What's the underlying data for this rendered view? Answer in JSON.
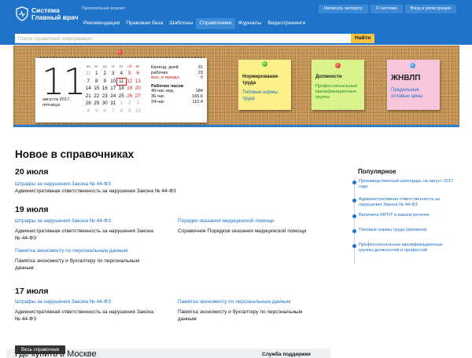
{
  "header": {
    "logo_line1": "Система",
    "logo_line2": "Главный врач",
    "promo": "Промоальная версия",
    "buttons": [
      "Написать эксперту",
      "О системе",
      "Вход и регистрация"
    ],
    "nav": [
      "Рекомендации",
      "Правовая база",
      "Шаблоны",
      "Справочники",
      "Журналы",
      "Видеотренинги"
    ],
    "active_nav": "Справочники"
  },
  "search": {
    "placeholder": "Поиск справочной информации",
    "button": "Найти"
  },
  "calendar": {
    "day": "11",
    "date_line1": "августа 2017,",
    "date_line2": "пятница",
    "weekdays": [
      "пн",
      "вт",
      "ср",
      "чт",
      "пт",
      "сб",
      "вс"
    ],
    "rows": [
      [
        "31",
        "1",
        "2",
        "3",
        "4",
        "5",
        "6"
      ],
      [
        "7",
        "8",
        "9",
        "10",
        "11",
        "12",
        "13"
      ],
      [
        "14",
        "15",
        "16",
        "17",
        "18",
        "19",
        "20"
      ],
      [
        "21",
        "22",
        "23",
        "24",
        "25",
        "26",
        "27"
      ],
      [
        "28",
        "29",
        "30",
        "31",
        "1",
        "2",
        "3"
      ],
      [
        "4",
        "5",
        "6",
        "7",
        "8",
        "9",
        "10"
      ]
    ],
    "info": {
      "cal_label1": "Календ. дней",
      "cal_value": "31",
      "cal_label2": "рабочих",
      "work_value": "23",
      "off_label": "вых. и праздн.",
      "off_value": "8",
      "hours_title": "Рабочих часов",
      "h40_label": "40-час нед.",
      "h40_value": "184",
      "h36_label": "36-час",
      "h36_value": "165.6",
      "h24_label": "24-час",
      "h24_value": "110.4"
    }
  },
  "notes": [
    {
      "title": "Нормирование труда",
      "sub": "Типовые нормы труда"
    },
    {
      "title": "Должности",
      "sub": "Профессиональные квалификационные группы"
    },
    {
      "title": "ЖНВЛП",
      "sub": "Предельные оптовые цены"
    }
  ],
  "main": {
    "title": "Новое в справочниках",
    "days": [
      {
        "date": "20 июля",
        "items": [
          {
            "link": "Штрафы за нарушения Закона № 44-ФЗ",
            "desc": "Административная ответственность за нарушения Закона № 44-ФЗ"
          }
        ]
      },
      {
        "date": "19 июля",
        "items": [
          {
            "link": "Штрафы за нарушения Закона № 44-ФЗ",
            "desc": "Административная ответственность за нарушения Закона № 44-ФЗ"
          },
          {
            "link": "Порядки оказания медицинской помощи",
            "desc": "Справочник Порядков оказания медицинской помощи"
          },
          {
            "link": "Памятка экономисту по персональным данным",
            "desc": "Памятка экономисту и бухгалтеру по персональным данным"
          }
        ]
      },
      {
        "date": "17 июля",
        "items": [
          {
            "link": "Штрафы за нарушения Закона № 44-ФЗ",
            "desc": "Административная ответственность за нарушения Закона № 44-ФЗ"
          },
          {
            "link": "Памятка экономисту по персональным данным",
            "desc": "Памятка экономисту и бухгалтеру по персональным данным"
          }
        ]
      }
    ]
  },
  "popular": {
    "title": "Популярное",
    "items": [
      "Производственный календарь на август 2017 года",
      "Административная ответственность за нарушения Закона № 44-ФЗ",
      "Величина МРОТ в вашем регионе",
      "Типовые нормы труда (времени)",
      "Профессиональные квалификационные группы должностей и профессий"
    ]
  },
  "bottom": {
    "all_button": "Весь справочник",
    "heading": "Где купить в Москве",
    "service": "Служба поддержки"
  },
  "colors": {
    "brand": "#1f73c9",
    "accent": "#f6c342",
    "link": "#1b6fc5",
    "weekend": "#d01818"
  }
}
